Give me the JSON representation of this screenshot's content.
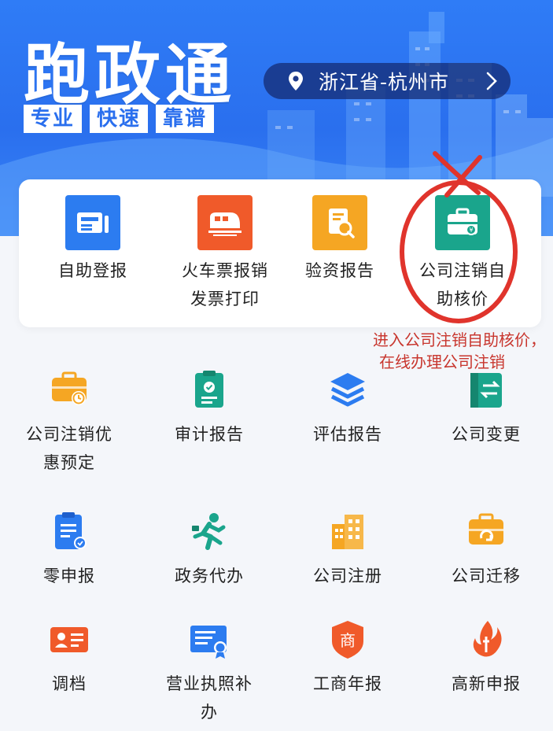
{
  "banner": {
    "title": "跑政通",
    "tags": [
      "专业",
      "快速",
      "靠谱"
    ],
    "location": "浙江省-杭州市"
  },
  "featured": [
    {
      "label": "自助登报",
      "icon": "newspaper-icon",
      "color": "#2c7cf0"
    },
    {
      "label": "火车票报销\n发票打印",
      "icon": "train-icon",
      "color": "#f05a2a"
    },
    {
      "label": "验资报告",
      "icon": "report-search-icon",
      "color": "#f5a623"
    },
    {
      "label": "公司注销自\n助核价",
      "icon": "briefcase-icon",
      "color": "#1aa58c"
    }
  ],
  "services": [
    {
      "label": "公司注销优\n惠预定",
      "icon": "briefcase-clock-icon"
    },
    {
      "label": "审计报告",
      "icon": "clipboard-check-icon"
    },
    {
      "label": "评估报告",
      "icon": "layers-icon"
    },
    {
      "label": "公司变更",
      "icon": "transfer-icon"
    },
    {
      "label": "零申报",
      "icon": "clipboard-badge-icon"
    },
    {
      "label": "政务代办",
      "icon": "runner-icon"
    },
    {
      "label": "公司注册",
      "icon": "building-icon"
    },
    {
      "label": "公司迁移",
      "icon": "briefcase-refresh-icon"
    },
    {
      "label": "调档",
      "icon": "id-card-icon"
    },
    {
      "label": "营业执照补\n办",
      "icon": "license-icon"
    },
    {
      "label": "工商年报",
      "icon": "shang-badge-icon"
    },
    {
      "label": "高新申报",
      "icon": "flame-logo-icon"
    }
  ],
  "annotation": {
    "line1": "进入公司注销自助核价，",
    "line2": "在线办理公司注销",
    "color": "#d93a30"
  }
}
